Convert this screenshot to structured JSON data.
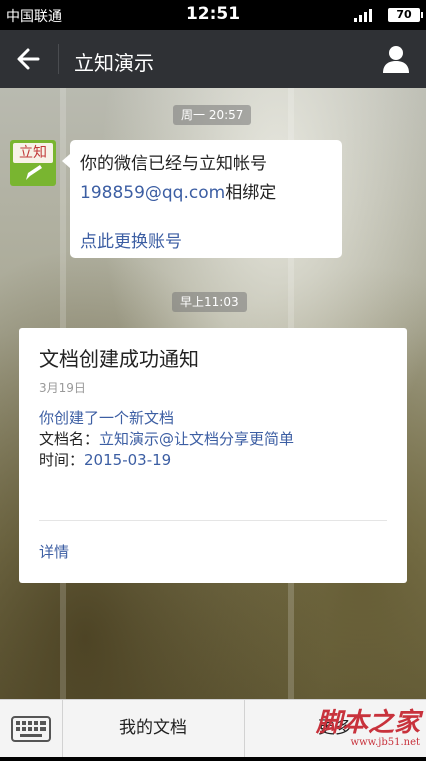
{
  "status_bar": {
    "carrier": "中国联通",
    "time": "12:51",
    "battery": "70"
  },
  "header": {
    "title": "立知演示"
  },
  "chat": {
    "first_timestamp": "周一 20:57",
    "second_timestamp": "早上11:03",
    "avatar_label": "立知",
    "message": {
      "line1": "你的微信已经与立知帐号",
      "email": "198859@qq.com",
      "line2_suffix": "相绑定",
      "action": "点此更换账号"
    },
    "card": {
      "title": "文档创建成功通知",
      "date": "3月19日",
      "line1": "你创建了一个新文档",
      "doc_label": "文档名：",
      "doc_value": "立知演示@让文档分享更简单",
      "time_label": "时间：",
      "time_value": "2015-03-19",
      "detail": "详情"
    }
  },
  "bottom_bar": {
    "my_docs": "我的文档",
    "more": "更多"
  },
  "watermark": {
    "text": "脚本之家",
    "url": "www.jb51.net"
  },
  "colors": {
    "nav_bg": "#2f3135",
    "link": "#3c5ea3",
    "avatar_green": "#79b530"
  },
  "icons": [
    "back-arrow-icon",
    "contact-icon",
    "pencil-icon",
    "keyboard-icon"
  ]
}
